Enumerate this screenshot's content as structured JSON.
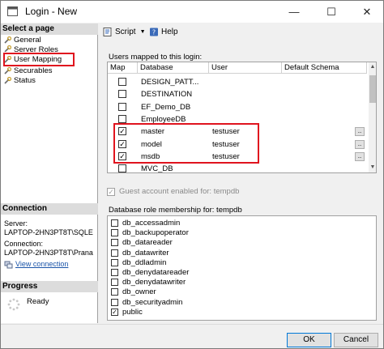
{
  "window": {
    "title": "Login - New",
    "minimize": "—",
    "maximize": "☐",
    "close": "✕"
  },
  "left": {
    "select_page_header": "Select a page",
    "pages": [
      "General",
      "Server Roles",
      "User Mapping",
      "Securables",
      "Status"
    ],
    "connection_header": "Connection",
    "server_label": "Server:",
    "server_value": "LAPTOP-2HN3PT8T\\SQLE",
    "connection_label": "Connection:",
    "connection_value": "LAPTOP-2HN3PT8T\\Prana",
    "view_connection": "View connection",
    "progress_header": "Progress",
    "progress_status": "Ready"
  },
  "toolbar": {
    "script": "Script",
    "help": "Help"
  },
  "mapping": {
    "label": "Users mapped to this login:",
    "headers": [
      "Map",
      "Database",
      "User",
      "Default Schema"
    ],
    "rows": [
      {
        "mapped": false,
        "database": "DESIGN_PATT...",
        "user": "",
        "schema": ""
      },
      {
        "mapped": false,
        "database": "DESTINATION",
        "user": "",
        "schema": ""
      },
      {
        "mapped": false,
        "database": "EF_Demo_DB",
        "user": "",
        "schema": ""
      },
      {
        "mapped": false,
        "database": "EmployeeDB",
        "user": "",
        "schema": ""
      },
      {
        "mapped": true,
        "database": "master",
        "user": "testuser",
        "schema": ""
      },
      {
        "mapped": true,
        "database": "model",
        "user": "testuser",
        "schema": ""
      },
      {
        "mapped": true,
        "database": "msdb",
        "user": "testuser",
        "schema": ""
      },
      {
        "mapped": false,
        "database": "MVC_DB",
        "user": "",
        "schema": ""
      }
    ]
  },
  "guest": {
    "label": "Guest account enabled for: tempdb",
    "checked": true
  },
  "roles": {
    "label": "Database role membership for: tempdb",
    "items": [
      {
        "name": "db_accessadmin",
        "checked": false
      },
      {
        "name": "db_backupoperator",
        "checked": false
      },
      {
        "name": "db_datareader",
        "checked": false
      },
      {
        "name": "db_datawriter",
        "checked": false
      },
      {
        "name": "db_ddladmin",
        "checked": false
      },
      {
        "name": "db_denydatareader",
        "checked": false
      },
      {
        "name": "db_denydatawriter",
        "checked": false
      },
      {
        "name": "db_owner",
        "checked": false
      },
      {
        "name": "db_securityadmin",
        "checked": false
      },
      {
        "name": "public",
        "checked": true
      }
    ]
  },
  "buttons": {
    "ok": "OK",
    "cancel": "Cancel"
  },
  "colors": {
    "highlight": "#e0141e",
    "link": "#1a54a8"
  }
}
